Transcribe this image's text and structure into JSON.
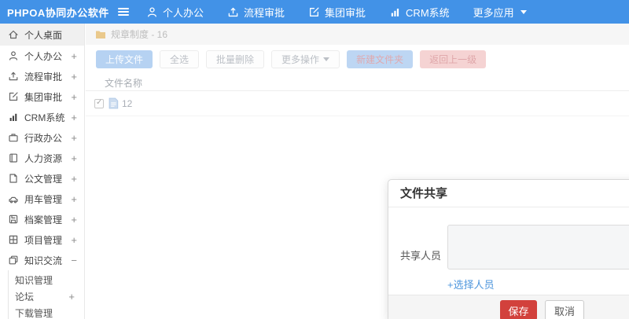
{
  "header": {
    "logo": "PHPOA协同办公软件",
    "nav": [
      {
        "label": "个人办公",
        "icon": "user-icon",
        "caret": false
      },
      {
        "label": "流程审批",
        "icon": "upload-icon",
        "caret": false
      },
      {
        "label": "集团审批",
        "icon": "edit-icon",
        "caret": false
      },
      {
        "label": "CRM系统",
        "icon": "chart-icon",
        "caret": false
      },
      {
        "label": "更多应用",
        "icon": "",
        "caret": true
      }
    ]
  },
  "sidebar": {
    "items": [
      {
        "label": "个人桌面",
        "icon": "home-icon",
        "toggle": "",
        "active": true
      },
      {
        "label": "个人办公",
        "icon": "user-icon",
        "toggle": "+"
      },
      {
        "label": "流程审批",
        "icon": "upload-icon",
        "toggle": "+"
      },
      {
        "label": "集团审批",
        "icon": "edit-icon",
        "toggle": "+"
      },
      {
        "label": "CRM系统",
        "icon": "chart-icon",
        "toggle": "+"
      },
      {
        "label": "行政办公",
        "icon": "briefcase-icon",
        "toggle": "+"
      },
      {
        "label": "人力资源",
        "icon": "book-icon",
        "toggle": "+"
      },
      {
        "label": "公文管理",
        "icon": "document-icon",
        "toggle": "+"
      },
      {
        "label": "用车管理",
        "icon": "car-icon",
        "toggle": "+"
      },
      {
        "label": "档案管理",
        "icon": "archive-icon",
        "toggle": "+"
      },
      {
        "label": "项目管理",
        "icon": "project-icon",
        "toggle": "+"
      },
      {
        "label": "知识交流",
        "icon": "share-icon",
        "toggle": "−",
        "expanded": true
      }
    ],
    "subitems": [
      {
        "label": "知识管理",
        "toggle": ""
      },
      {
        "label": "论坛",
        "toggle": "+"
      },
      {
        "label": "下载管理",
        "toggle": ""
      }
    ]
  },
  "breadcrumb": {
    "label": "规章制度 - 16"
  },
  "toolbar": {
    "upload": "上传文件",
    "select_all": "全选",
    "batch_delete": "批量删除",
    "more": "更多操作",
    "new_folder": "新建文件夹",
    "back": "返回上一级"
  },
  "filetable": {
    "name_header": "文件名称",
    "rows": [
      {
        "name": "12",
        "checked": true
      }
    ]
  },
  "modal": {
    "title": "文件共享",
    "share_label": "共享人员",
    "textarea_value": "",
    "select_link": "+选择人员",
    "save": "保存",
    "cancel": "取消"
  },
  "colors": {
    "topbar_blue": "#4292e7",
    "link_blue": "#4e96dd",
    "danger_red": "#d2413c",
    "washed_button_blue": "#b6d2f2",
    "washed_button_pink": "#f5d3d3"
  }
}
